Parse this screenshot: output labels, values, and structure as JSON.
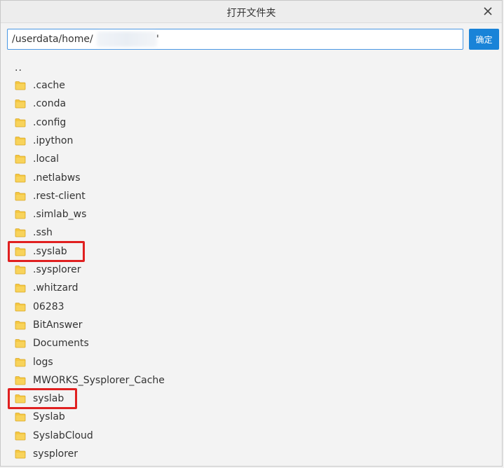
{
  "dialog": {
    "title": "打开文件夹",
    "path_value": "/userdata/home/",
    "path_suffix": "'",
    "confirm_label": "确定"
  },
  "list": {
    "parent_label": "..",
    "folders": [
      ".cache",
      ".conda",
      ".config",
      ".ipython",
      ".local",
      ".netlabws",
      ".rest-client",
      ".simlab_ws",
      ".ssh",
      ".syslab",
      ".sysplorer",
      ".whitzard",
      "06283",
      "BitAnswer",
      "Documents",
      "logs",
      "MWORKS_Sysplorer_Cache",
      "syslab",
      "Syslab",
      "SyslabCloud",
      "sysplorer"
    ],
    "highlighted": [
      ".syslab",
      "syslab"
    ]
  },
  "colors": {
    "accent": "#1983d8",
    "input_border": "#4a97e3",
    "highlight": "#e02020",
    "folder": "#f5c842"
  },
  "icons": {
    "close": "close-icon",
    "folder": "folder-icon"
  }
}
